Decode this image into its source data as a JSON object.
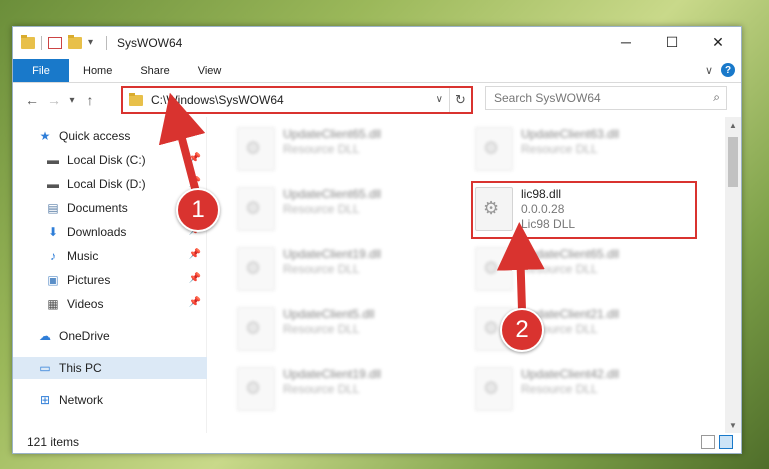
{
  "window": {
    "title": "SysWOW64",
    "controls": {
      "minimize": "─",
      "maximize": "☐",
      "close": "✕"
    }
  },
  "ribbon": {
    "tabs": [
      "File",
      "Home",
      "Share",
      "View"
    ],
    "expand": "∨",
    "help": "?"
  },
  "navbar": {
    "back": "←",
    "forward": "→",
    "recent": "▾",
    "up": "↑",
    "path": "C:\\Windows\\SysWOW64",
    "refresh": "↻",
    "dropdown": "∨",
    "search_placeholder": "Search SysWOW64",
    "search_icon": "⌕"
  },
  "sidebar": {
    "items": [
      {
        "label": "Quick access",
        "icon": "star-icon",
        "glyph": "★",
        "color": "#2f7ed8",
        "pinned": false
      },
      {
        "label": "Local Disk (C:)",
        "icon": "disk-icon",
        "glyph": "▬",
        "color": "#555555",
        "pinned": true
      },
      {
        "label": "Local Disk (D:)",
        "icon": "disk-icon",
        "glyph": "▬",
        "color": "#555555",
        "pinned": true
      },
      {
        "label": "Documents",
        "icon": "documents-icon",
        "glyph": "▤",
        "color": "#5b7fa8",
        "pinned": true
      },
      {
        "label": "Downloads",
        "icon": "download-icon",
        "glyph": "⬇",
        "color": "#2f7ed8",
        "pinned": true
      },
      {
        "label": "Music",
        "icon": "music-icon",
        "glyph": "♪",
        "color": "#2f7ed8",
        "pinned": true
      },
      {
        "label": "Pictures",
        "icon": "pictures-icon",
        "glyph": "▣",
        "color": "#5b8fc8",
        "pinned": true
      },
      {
        "label": "Videos",
        "icon": "videos-icon",
        "glyph": "▦",
        "color": "#555555",
        "pinned": true
      },
      {
        "label": "OneDrive",
        "icon": "cloud-icon",
        "glyph": "☁",
        "color": "#2f7ed8",
        "pinned": false
      },
      {
        "label": "This PC",
        "icon": "computer-icon",
        "glyph": "▭",
        "color": "#2f7ed8",
        "pinned": false
      },
      {
        "label": "Network",
        "icon": "network-icon",
        "glyph": "⊞",
        "color": "#2f7ed8",
        "pinned": false
      }
    ],
    "pin_glyph": "📌"
  },
  "files": [
    {
      "name": "UpdateClient65.dll",
      "type": "Resource DLL",
      "version": ""
    },
    {
      "name": "UpdateClient63.dll",
      "type": "Resource DLL",
      "version": ""
    },
    {
      "name": "UpdateClient65.dll",
      "type": "Resource DLL",
      "version": ""
    },
    {
      "name": "lic98.dll",
      "type": "Lic98 DLL",
      "version": "0.0.0.28"
    },
    {
      "name": "UpdateClient19.dll",
      "type": "Resource DLL",
      "version": ""
    },
    {
      "name": "UpdateClient65.dll",
      "type": "Resource DLL",
      "version": ""
    },
    {
      "name": "UpdateClient5.dll",
      "type": "Resource DLL",
      "version": ""
    },
    {
      "name": "UpdateClient21.dll",
      "type": "Resource DLL",
      "version": ""
    },
    {
      "name": "UpdateClient19.dll",
      "type": "Resource DLL",
      "version": ""
    },
    {
      "name": "UpdateClient42.dll",
      "type": "Resource DLL",
      "version": ""
    }
  ],
  "status": {
    "items": "121 items"
  },
  "callouts": [
    "1",
    "2"
  ],
  "colors": {
    "accent": "#1979ca",
    "highlight": "#d9332f"
  }
}
